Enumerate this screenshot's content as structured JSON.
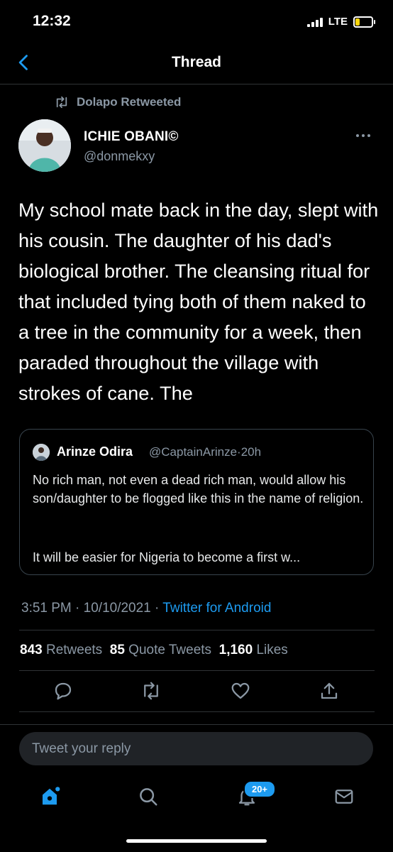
{
  "status_bar": {
    "time": "12:32",
    "network": "LTE"
  },
  "header": {
    "title": "Thread"
  },
  "retweet": {
    "label": "Dolapo Retweeted"
  },
  "author": {
    "name": "ICHIE OBANI©",
    "handle": "@donmekxy"
  },
  "tweet": {
    "text": "My school mate back in the day, slept with his cousin. The daughter of his dad's biological brother. The cleansing ritual for that included tying both of them naked to a tree in the community for a week, then paraded throughout the village with strokes of cane. The"
  },
  "quoted": {
    "name": "Arinze Odira",
    "handle": "@CaptainArinze",
    "separator": "·",
    "age": "20h",
    "text": "No rich man, not even a dead rich man, would allow his son/daughter to be flogged like this in the name of religion.",
    "text2": "It will be easier for Nigeria to become a first w..."
  },
  "timestamp": {
    "time": "3:51 PM",
    "sep1": "·",
    "date": "10/10/2021",
    "sep2": "·",
    "source": "Twitter for Android"
  },
  "stats": {
    "retweets": "843",
    "retweets_label": "Retweets",
    "quotes": "85",
    "quotes_label": "Quote Tweets",
    "likes": "1,160",
    "likes_label": "Likes"
  },
  "actions": [
    "reply-icon",
    "retweet-icon",
    "like-icon",
    "share-icon"
  ],
  "reply": {
    "placeholder": "Tweet your reply"
  },
  "nav": {
    "items": [
      "home-icon",
      "search-icon",
      "notifications-icon",
      "messages-icon"
    ],
    "notifications_badge": "20+"
  },
  "colors": {
    "accent": "#1d9bf0",
    "background": "#000000",
    "muted": "#8b98a5"
  }
}
